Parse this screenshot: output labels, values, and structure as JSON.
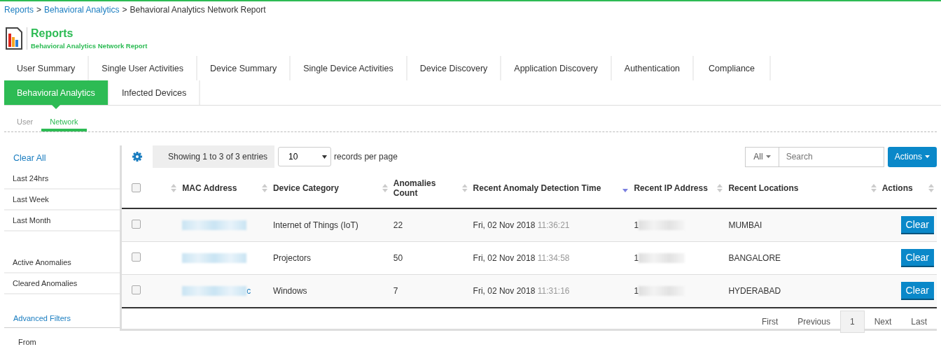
{
  "breadcrumb": [
    {
      "label": "Reports",
      "link": true
    },
    {
      "label": "Behavioral Analytics",
      "link": true
    },
    {
      "label": "Behavioral Analytics Network Report",
      "link": false
    }
  ],
  "breadcrumb_separator": ">",
  "header": {
    "title": "Reports",
    "subtitle": "Behavioral Analytics Network Report"
  },
  "tabs": [
    {
      "label": "User Summary",
      "selected": false
    },
    {
      "label": "Single User Activities",
      "selected": false
    },
    {
      "label": "Device Summary",
      "selected": false
    },
    {
      "label": "Single Device Activities",
      "selected": false
    },
    {
      "label": "Device Discovery",
      "selected": false
    },
    {
      "label": "Application Discovery",
      "selected": false
    },
    {
      "label": "Authentication",
      "selected": false
    },
    {
      "label": "Compliance",
      "selected": false
    },
    {
      "label": "Behavioral Analytics",
      "selected": true
    },
    {
      "label": "Infected Devices",
      "selected": false
    }
  ],
  "subtabs": [
    {
      "label": "User",
      "selected": false
    },
    {
      "label": "Network",
      "selected": true
    }
  ],
  "sidebar": {
    "clear_all": "Clear All",
    "groups": [
      [
        {
          "label": "Last 24hrs"
        },
        {
          "label": "Last Week"
        },
        {
          "label": "Last Month"
        }
      ],
      [
        {
          "label": "Active Anomalies"
        },
        {
          "label": "Cleared Anomalies"
        }
      ]
    ],
    "advanced_filters": "Advanced Filters",
    "from_label": "From"
  },
  "toolbar": {
    "entries_info": "Showing 1 to 3 of 3 entries",
    "page_size": "10",
    "records_label": "records per page",
    "filter": "All",
    "search_placeholder": "Search",
    "actions": "Actions"
  },
  "table": {
    "select_all": {
      "checked": false
    },
    "columns": [
      {
        "label": "MAC Address",
        "sorted": false
      },
      {
        "label": "Device Category",
        "sorted": false
      },
      {
        "label": "Anomalies Count",
        "sorted": false
      },
      {
        "label": "Recent Anomaly Detection Time",
        "sorted": true
      },
      {
        "label": "Recent IP Address",
        "sorted": false
      },
      {
        "label": "Recent Locations",
        "sorted": false
      },
      {
        "label": "Actions",
        "sorted": false
      }
    ],
    "rows": [
      {
        "checked": false,
        "mac_tail": "",
        "category": "Internet of Things (IoT)",
        "count": "22",
        "date": "Fri, 02 Nov 2018",
        "time": "11:36:21",
        "ip_prefix": "1",
        "location": "MUMBAI",
        "action": "Clear"
      },
      {
        "checked": false,
        "mac_tail": "",
        "category": "Projectors",
        "count": "50",
        "date": "Fri, 02 Nov 2018",
        "time": "11:34:58",
        "ip_prefix": "1",
        "location": "BANGALORE",
        "action": "Clear"
      },
      {
        "checked": false,
        "mac_tail": "c",
        "category": "Windows",
        "count": "7",
        "date": "Fri, 02 Nov 2018",
        "time": "11:31:16",
        "ip_prefix": "1",
        "location": "HYDERABAD",
        "action": "Clear"
      }
    ]
  },
  "pagination": [
    {
      "label": "First",
      "selected": false
    },
    {
      "label": "Previous",
      "selected": false
    },
    {
      "label": "1",
      "selected": true
    },
    {
      "label": "Next",
      "selected": false
    },
    {
      "label": "Last",
      "selected": false
    }
  ]
}
